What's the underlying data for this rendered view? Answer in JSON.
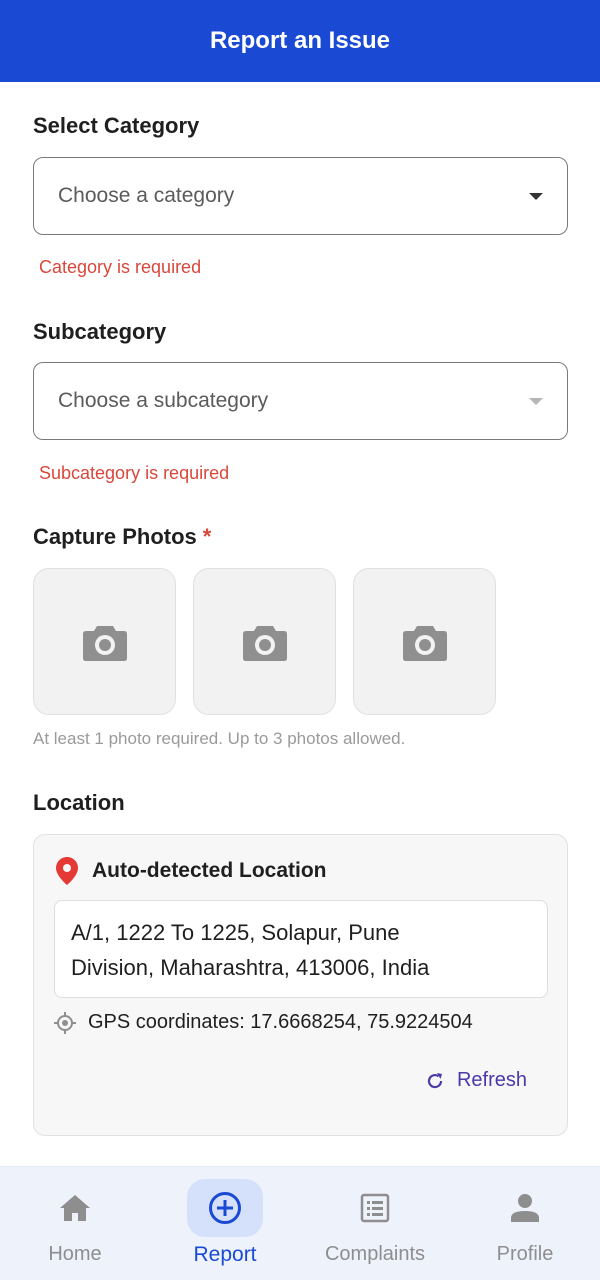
{
  "header": {
    "title": "Report an Issue"
  },
  "category": {
    "label": "Select Category",
    "placeholder": "Choose a category",
    "error": "Category is required"
  },
  "subcategory": {
    "label": "Subcategory",
    "placeholder": "Choose a subcategory",
    "error": "Subcategory is required"
  },
  "photos": {
    "label": "Capture Photos",
    "required_mark": "*",
    "hint": "At least 1 photo required. Up to 3 photos allowed.",
    "slot_count": 3
  },
  "location": {
    "label": "Location",
    "card_title": "Auto-detected Location",
    "address_line1": "A/1, 1222 To 1225, Solapur, Pune",
    "address_line2": "Division, Maharashtra, 413006, India",
    "gps_text": "GPS coordinates: 17.6668254, 75.9224504",
    "refresh_label": "Refresh"
  },
  "bottom_nav": {
    "items": [
      {
        "label": "Home",
        "icon": "home-icon",
        "active": false
      },
      {
        "label": "Report",
        "icon": "add-circle-icon",
        "active": true
      },
      {
        "label": "Complaints",
        "icon": "list-document-icon",
        "active": false
      },
      {
        "label": "Profile",
        "icon": "person-icon",
        "active": false
      }
    ]
  },
  "colors": {
    "primary": "#1a4ad3",
    "error": "#d9473b",
    "accent": "#4a3aa8",
    "nav_background": "#eef2fb",
    "nav_active_pill": "#d5e0fb"
  }
}
